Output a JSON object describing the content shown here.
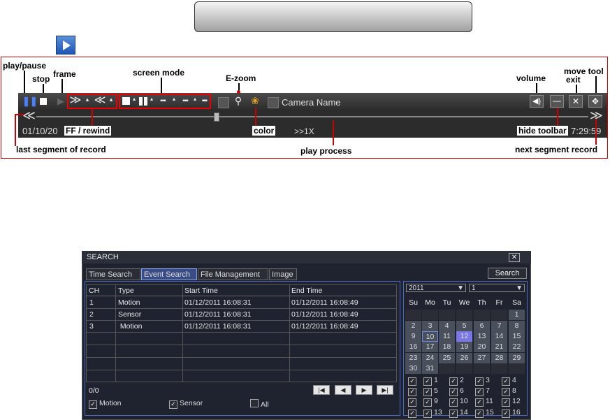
{
  "toolbar_figure": {
    "annotations": {
      "play_pause": "play/pause",
      "stop": "stop",
      "frame": "frame",
      "screen_mode": "screen mode",
      "e_zoom": "E-zoom",
      "volume": "volume",
      "move_tool": "move tool",
      "exit": "exit",
      "color": "color",
      "ff_rewind": "FF / rewind",
      "hide_toolbar": "hide toolbar",
      "last_segment": "last segment of record",
      "play_process": "play process",
      "next_segment": "next segment record"
    },
    "camera_name": "Camera Name",
    "date_left": "01/10/20",
    "time_right": "7:29:59",
    "speed": ">>1X"
  },
  "search_window": {
    "title": "SEARCH",
    "close": "✕",
    "tabs": [
      "Time Search",
      "Event Search",
      "File Management",
      "Image"
    ],
    "search_button": "Search",
    "table": {
      "headers": [
        "CH",
        "Type",
        "Start Time",
        "End Time"
      ],
      "rows": [
        {
          "ch": "1",
          "type": "Motion",
          "start": "01/12/2011 16:08:31",
          "end": "01/12/2011 16:08:49"
        },
        {
          "ch": "2",
          "type": "Sensor",
          "start": "01/12/2011 16:08:31",
          "end": "01/12/2011 16:08:49"
        },
        {
          "ch": "3",
          "type": " Motion",
          "start": "01/12/2011 16:08:31",
          "end": "01/12/2011 16:08:49"
        }
      ],
      "page": "0/0"
    },
    "filters": {
      "motion": "Motion",
      "sensor": "Sensor",
      "all": "All"
    },
    "calendar": {
      "year": "2011",
      "month": "1",
      "days_header": [
        "Su",
        "Mo",
        "Tu",
        "We",
        "Th",
        "Fr",
        "Sa"
      ],
      "selected_day": "12",
      "outlined_day": "10"
    },
    "channels": [
      "1",
      "2",
      "3",
      "4",
      "5",
      "6",
      "7",
      "8",
      "9",
      "10",
      "11",
      "12",
      "13",
      "14",
      "15",
      "16"
    ]
  }
}
